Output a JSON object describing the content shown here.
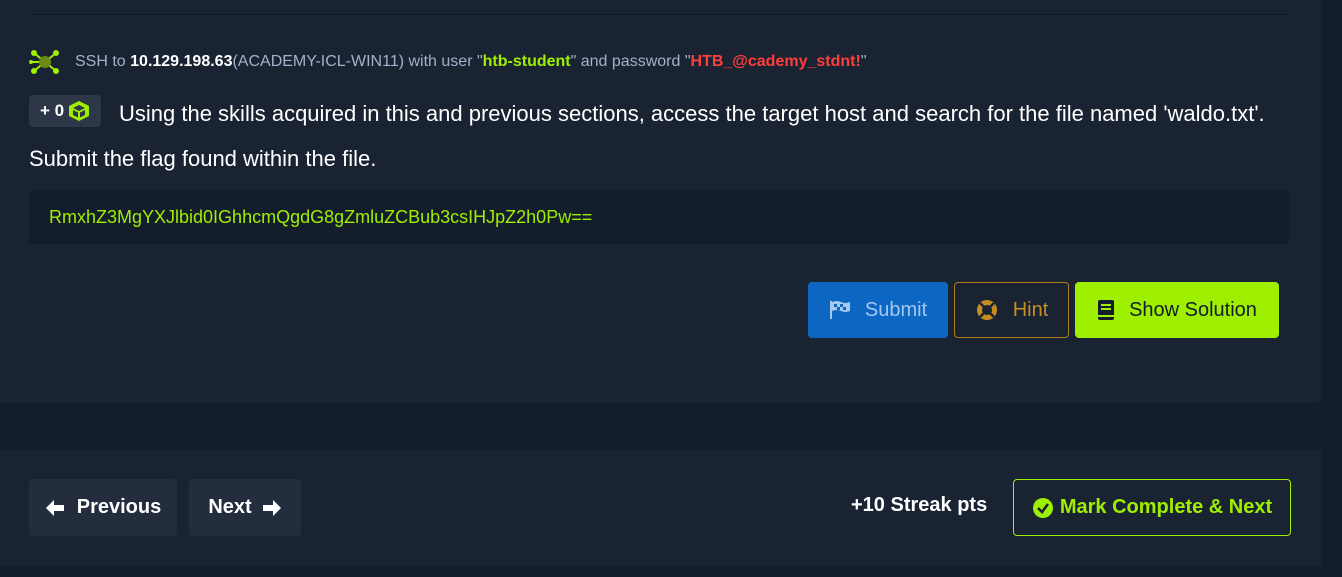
{
  "ssh": {
    "prefix": "SSH to ",
    "ip": "10.129.198.63",
    "host": " (ACADEMY-ICL-WIN11) with user \"",
    "user": "htb-student",
    "mid": "\" and password \"",
    "password": "HTB_@cademy_stdnt!",
    "suffix": "\""
  },
  "question": {
    "badge": "+ 0",
    "text": "Using the skills acquired in this and previous sections, access the target host and search for the file named 'waldo.txt'. Submit the flag found within the file."
  },
  "answer": {
    "value": "RmxhZ3MgYXJlbid0IGhhcmQgdG8gZmluZCBub3csIHJpZ2h0Pw=="
  },
  "buttons": {
    "submit": "Submit",
    "hint": "Hint",
    "solution": "Show Solution"
  },
  "footer": {
    "previous": "Previous",
    "next": "Next",
    "streak": "+10 Streak pts",
    "complete": "Mark Complete & Next"
  },
  "colors": {
    "accent": "#9fef00",
    "password": "#ff3e3e",
    "submit": "#0d66c2",
    "hint": "#c58d22",
    "background": "#141d2b",
    "card": "#1a2332"
  }
}
